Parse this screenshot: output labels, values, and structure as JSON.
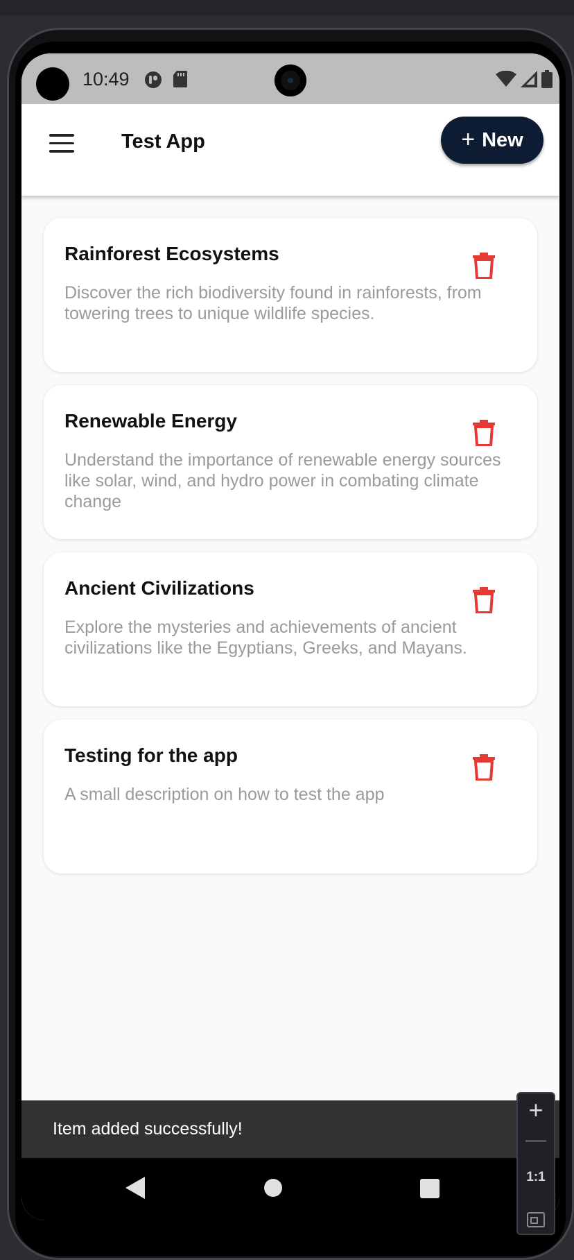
{
  "status_bar": {
    "time": "10:49",
    "left_icons": [
      "shield-icon",
      "sd-card-icon"
    ],
    "right_icons": [
      "wifi-icon",
      "cell-signal-icon",
      "battery-icon"
    ]
  },
  "app_bar": {
    "title": "Test App",
    "new_button_label": "New",
    "new_button_icon": "plus-icon",
    "accent_color": "#0d1b33"
  },
  "items": [
    {
      "title": "Rainforest Ecosystems",
      "description": "Discover the rich biodiversity found in rainforests, from towering trees to unique wildlife species."
    },
    {
      "title": "Renewable Energy",
      "description": "Understand the importance of renewable energy sources like solar, wind, and hydro power in combating climate change"
    },
    {
      "title": "Ancient Civilizations",
      "description": "Explore the mysteries and achievements of ancient civilizations like the Egyptians, Greeks, and Mayans."
    },
    {
      "title": "Testing for the app",
      "description": "A small description on how to test the app"
    }
  ],
  "delete_icon_color": "#e53935",
  "snackbar": {
    "message": "Item added successfully!"
  },
  "nav_bar": {
    "icons": [
      "back-icon",
      "home-icon",
      "recents-icon"
    ]
  },
  "zoom_panel": {
    "one_to_one_label": "1:1"
  }
}
